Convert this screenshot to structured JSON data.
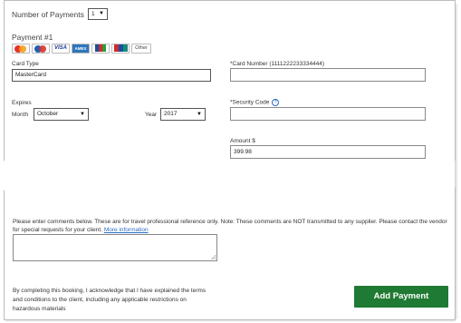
{
  "header": {
    "number_of_payments_label": "Number of Payments",
    "number_of_payments_value": "1"
  },
  "payment": {
    "title": "Payment #1",
    "card_logos": [
      "mastercard-icon",
      "maestro-icon",
      "VISA",
      "AMEX",
      "jcb-icon",
      "unionpay-icon",
      "Other"
    ],
    "card_type_label": "Card Type",
    "card_type_value": "MasterCard",
    "card_number_label": "*Card Number (1111222233334444)",
    "card_number_value": "",
    "expires_label": "Expires",
    "month_label": "Month",
    "month_value": "October",
    "year_label": "Year",
    "year_value": "2017",
    "security_code_label": "*Security Code",
    "security_code_help": "?",
    "security_code_value": "",
    "amount_label": "Amount $",
    "amount_value": "399.98"
  },
  "comments": {
    "instructions": "Please enter comments below. These are for travel professional reference only. Note: These comments are NOT transmitted to any supplier. Please contact the vendor for special requests for your client.",
    "more_info_link": "More information",
    "value": ""
  },
  "footer": {
    "acknowledgement_line1": "By completing this booking, I acknowledge that I have explained the terms",
    "acknowledgement_line2": "and conditions to the client, including any applicable restrictions on",
    "acknowledgement_line3": "hazardous materials",
    "add_payment_label": "Add Payment"
  },
  "colors": {
    "button_green": "#1f7a33",
    "link_blue": "#2b6cc4"
  }
}
